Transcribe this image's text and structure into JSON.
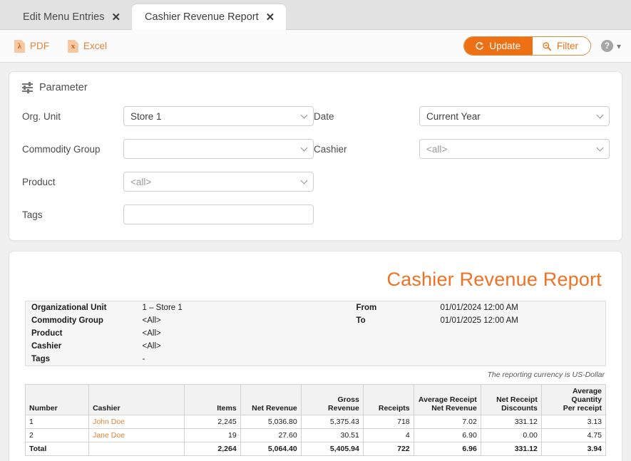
{
  "tabs": [
    {
      "label": "Edit Menu Entries",
      "close": "✕",
      "active": false
    },
    {
      "label": "Cashier Revenue Report",
      "close": "✕",
      "active": true
    }
  ],
  "toolbar": {
    "pdf_label": "PDF",
    "pdf_glyph": "λ",
    "excel_label": "Excel",
    "excel_glyph": "x",
    "update_label": "Update",
    "filter_label": "Filter",
    "help_glyph": "?",
    "chevron_glyph": "⌄",
    "accent_color": "#ed7015"
  },
  "parameter": {
    "section_title": "Parameter",
    "fields": {
      "org_unit_label": "Org. Unit",
      "org_unit_value": "Store 1",
      "commodity_group_label": "Commodity Group",
      "commodity_group_value": "",
      "product_label": "Product",
      "product_value": "<all>",
      "tags_label": "Tags",
      "tags_value": "",
      "date_label": "Date",
      "date_value": "Current Year",
      "cashier_label": "Cashier",
      "cashier_value": "<all>"
    }
  },
  "report": {
    "title": "Cashier Revenue Report",
    "info": {
      "left": [
        {
          "key": "Organizational Unit",
          "value": "1 – Store 1"
        },
        {
          "key": "Commodity Group",
          "value": "<All>"
        },
        {
          "key": "Product",
          "value": "<All>"
        },
        {
          "key": "Cashier",
          "value": "<All>"
        },
        {
          "key": "Tags",
          "value": "-"
        }
      ],
      "right": [
        {
          "key": "From",
          "value": "01/01/2024 12:00 AM"
        },
        {
          "key": "To",
          "value": "01/01/2025 12:00 AM"
        }
      ]
    },
    "currency_note": "The reporting currency is US-Dollar",
    "table": {
      "headers": [
        "Number",
        "Cashier",
        "Items",
        "Net Revenue",
        "Gross Revenue",
        "Receipts",
        "Average Receipt\nNet Revenue",
        "Net Receipt\nDiscounts",
        "Average Quantity\nPer receipt"
      ],
      "headers_split": [
        {
          "l1": "Number",
          "l2": ""
        },
        {
          "l1": "Cashier",
          "l2": ""
        },
        {
          "l1": "Items",
          "l2": ""
        },
        {
          "l1": "Net Revenue",
          "l2": ""
        },
        {
          "l1": "Gross Revenue",
          "l2": ""
        },
        {
          "l1": "Receipts",
          "l2": ""
        },
        {
          "l1": "Average Receipt",
          "l2": "Net Revenue"
        },
        {
          "l1": "Net Receipt",
          "l2": "Discounts"
        },
        {
          "l1": "Average Quantity",
          "l2": "Per receipt"
        }
      ],
      "rows": [
        {
          "number": "1",
          "cashier": "John Doe",
          "items": "2,245",
          "net_revenue": "5,036.80",
          "gross_revenue": "5,375.43",
          "receipts": "718",
          "avg_receipt_net_revenue": "7.02",
          "net_receipt_discounts": "331.12",
          "avg_qty_per_receipt": "3.13"
        },
        {
          "number": "2",
          "cashier": "Jane Doe",
          "items": "19",
          "net_revenue": "27.60",
          "gross_revenue": "30.51",
          "receipts": "4",
          "avg_receipt_net_revenue": "6.90",
          "net_receipt_discounts": "0.00",
          "avg_qty_per_receipt": "4.75"
        }
      ],
      "total": {
        "number": "Total",
        "cashier": "",
        "items": "2,264",
        "net_revenue": "5,064.40",
        "gross_revenue": "5,405.94",
        "receipts": "722",
        "avg_receipt_net_revenue": "6.96",
        "net_receipt_discounts": "331.12",
        "avg_qty_per_receipt": "3.94"
      }
    }
  }
}
